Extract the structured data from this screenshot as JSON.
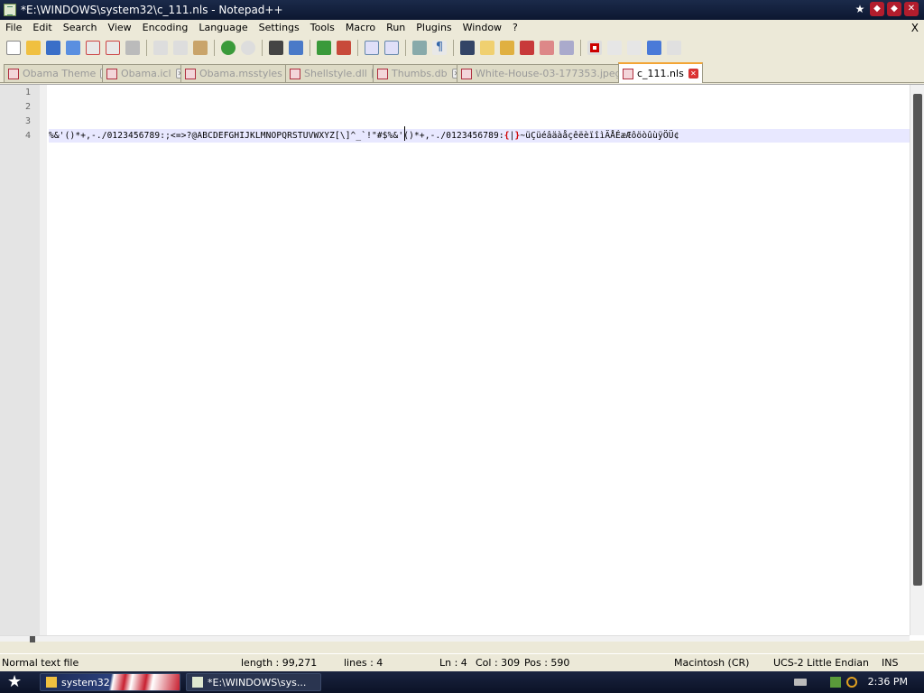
{
  "window": {
    "title": "*E:\\WINDOWS\\system32\\c_111.nls - Notepad++",
    "icon": "notepad-icon"
  },
  "menu": [
    "File",
    "Edit",
    "Search",
    "View",
    "Encoding",
    "Language",
    "Settings",
    "Tools",
    "Macro",
    "Run",
    "Plugins",
    "Window",
    "?"
  ],
  "menu_close": "X",
  "toolbar_icons": [
    "new-file-icon",
    "open-file-icon",
    "save-icon",
    "save-all-icon",
    "close-icon",
    "close-all-icon",
    "print-icon",
    "cut-icon",
    "copy-icon",
    "paste-icon",
    "undo-icon",
    "redo-icon",
    "find-icon",
    "replace-icon",
    "zoom-in-icon",
    "zoom-out-icon",
    "sync-v-icon",
    "sync-h-icon",
    "word-wrap-icon",
    "show-all-chars-icon",
    "indent-guide-icon",
    "doc-map-icon",
    "function-list-icon",
    "folder-icon",
    "monitor-icon",
    "eye-icon",
    "record-macro-icon",
    "stop-record-icon",
    "play-macro-icon",
    "run-macro-multi-icon",
    "save-macro-icon"
  ],
  "tabs": [
    {
      "label": "Obama Theme",
      "active": false
    },
    {
      "label": "Obama.icl",
      "active": false
    },
    {
      "label": "Obama.msstyles",
      "active": false
    },
    {
      "label": "Shellstyle.dll",
      "active": false
    },
    {
      "label": "Thumbs.db",
      "active": false
    },
    {
      "label": "White-House-03-177353.jpeg",
      "active": false
    },
    {
      "label": "c_111.nls",
      "active": true
    }
  ],
  "editor": {
    "line_numbers": [
      "1",
      "2",
      "3",
      "4"
    ],
    "line4_pre": "%&'()*+,-./0123456789:;<=>?@ABCDEFGHIJKLMNOPQRSTUVWXYZ[\\]^_`!\"#$%&'()*+,-./0123456789:",
    "line4_brace_open": "{",
    "line4_pipe": "|",
    "line4_brace_close": "}",
    "line4_post": "~üÇüéâäàåçêëèïîìÄÅÉæÆôöòûùÿÖÜ¢"
  },
  "status": {
    "type": "Normal text file",
    "length": "length : 99,271",
    "lines": "lines : 4",
    "ln": "Ln : 4",
    "col": "Col : 309",
    "pos": "Pos : 590",
    "eol": "Macintosh (CR)",
    "encoding": "UCS-2 Little Endian",
    "mode": "INS"
  },
  "taskbar": {
    "task1": "system32",
    "task2": "*E:\\WINDOWS\\sys...",
    "clock": "2:36 PM"
  },
  "colors": {
    "titlebar": "#0c1730",
    "current_line": "#E8E8FF",
    "brace_highlight": "#d00000",
    "active_tab_accent": "#f3a535"
  }
}
